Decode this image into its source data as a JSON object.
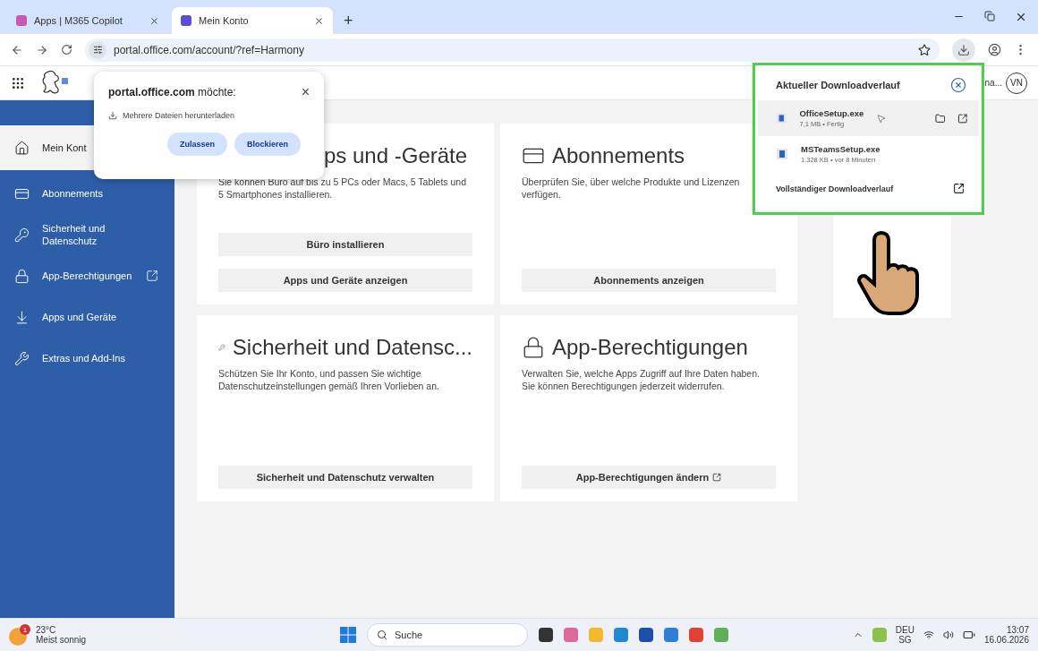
{
  "browser": {
    "tabs": [
      {
        "title": "Apps | M365 Copilot",
        "selected": false
      },
      {
        "title": "Mein Konto",
        "selected": true
      }
    ],
    "new_tab": "+",
    "address": "portal.office.com/account/?ref=Harmony"
  },
  "header": {
    "user_name": "na...",
    "avatar": "VN"
  },
  "sidebar": {
    "items": [
      {
        "label": "Mein Kont",
        "selected": true,
        "external": false
      },
      {
        "label": "Abonnements",
        "selected": false,
        "external": false
      },
      {
        "label": "Sicherheit und Datenschutz",
        "selected": false,
        "external": false
      },
      {
        "label": "App-Berechtigungen",
        "selected": false,
        "external": true
      },
      {
        "label": "Apps und Geräte",
        "selected": false,
        "external": false
      },
      {
        "label": "Extras und Add-Ins",
        "selected": false,
        "external": false
      }
    ]
  },
  "cards": [
    {
      "title": "ps und -Geräte",
      "description": "Sie können Büro auf bis zu 5 PCs oder Macs, 5 Tablets und 5 Smartphones installieren.",
      "buttons": [
        {
          "label": "Büro installieren",
          "external": false
        },
        {
          "label": "Apps und Geräte anzeigen",
          "external": false
        }
      ]
    },
    {
      "title": "Abonnements",
      "description": "Überprüfen Sie, über welche Produkte und Lizenzen verfügen.",
      "buttons": [
        {
          "label": "Abonnements anzeigen",
          "external": false
        }
      ]
    },
    {
      "title": "Sicherheit und Datensc...",
      "description": "Schützen Sie Ihr Konto, und passen Sie wichtige Datenschutzeinstellungen gemäß Ihren Vorlieben an.",
      "buttons": [
        {
          "label": "Sicherheit und Datenschutz verwalten",
          "external": false
        }
      ]
    },
    {
      "title": "App-Berechtigungen",
      "description": "Verwalten Sie, welche Apps Zugriff auf Ihre Daten haben. Sie können Berechtigungen jederzeit widerrufen.",
      "buttons": [
        {
          "label": "App-Berechtigungen ändern",
          "external": true
        }
      ]
    }
  ],
  "permission_prompt": {
    "title": "**portal.office.com** möchte:",
    "close": "×",
    "request": "Mehrere Dateien herunterladen",
    "buttons": [
      "Zulassen",
      "Blockieren"
    ]
  },
  "downloads": {
    "title": "Aktueller Downloadverlauf",
    "items": [
      {
        "name": "OfficeSetup.exe",
        "meta": "7,1 MB • Fertig",
        "selected": true
      },
      {
        "name": "MSTeamsSetup.exe",
        "meta": "1.328 KB • vor 8 Minuten",
        "selected": false
      }
    ],
    "footer": "Vollständiger Downloadverlauf"
  },
  "taskbar": {
    "weather": {
      "badge": "1",
      "temperature": "23°C",
      "condition": "Meist sonnig"
    },
    "search": "Suche",
    "tray": {
      "language": "DEU",
      "region": "SG",
      "time": "13:07",
      "date": "16.06.2026"
    }
  }
}
